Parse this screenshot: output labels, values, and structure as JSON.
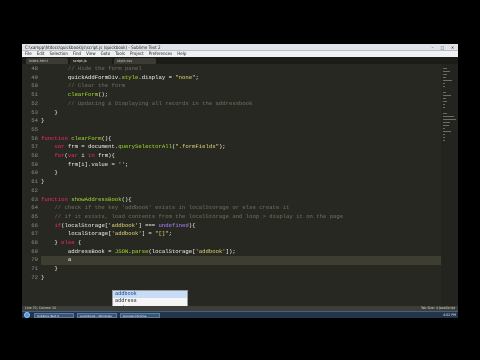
{
  "window": {
    "title": "C:\\xampp\\htdocs\\quickbook\\js\\script.js (quickbook) - Sublime Text 2",
    "buttons": [
      "–",
      "□",
      "✕"
    ]
  },
  "menubar": [
    "File",
    "Edit",
    "Selection",
    "Find",
    "View",
    "Goto",
    "Tools",
    "Project",
    "Preferences",
    "Help"
  ],
  "tabs": [
    {
      "label": "index.html",
      "active": false
    },
    {
      "label": "script.js",
      "active": true
    },
    {
      "label": "style.css",
      "active": false
    }
  ],
  "editor": {
    "current_line": 70,
    "lines": [
      {
        "n": "48",
        "parts": [
          [
            "        ",
            "tx"
          ],
          [
            "// Hide the form panel",
            "cm"
          ]
        ]
      },
      {
        "n": "49",
        "parts": [
          [
            "        quickAddFormDiv.",
            "tx"
          ],
          [
            "style",
            "fn"
          ],
          [
            ".display = ",
            "tx"
          ],
          [
            "\"none\"",
            "st"
          ],
          [
            ";",
            "tx"
          ]
        ]
      },
      {
        "n": "50",
        "parts": [
          [
            "        ",
            "tx"
          ],
          [
            "// Clear the form",
            "cm"
          ]
        ]
      },
      {
        "n": "51",
        "parts": [
          [
            "        ",
            "tx"
          ],
          [
            "clearForm",
            "fn"
          ],
          [
            "();",
            "tx"
          ]
        ]
      },
      {
        "n": "52",
        "parts": [
          [
            "        ",
            "tx"
          ],
          [
            "// Updating & Displaying all records in the addressbook",
            "cm"
          ]
        ]
      },
      {
        "n": "53",
        "parts": [
          [
            "    }",
            "tx"
          ]
        ]
      },
      {
        "n": "54",
        "parts": [
          [
            "}",
            "tx"
          ]
        ]
      },
      {
        "n": "55",
        "parts": [
          [
            "",
            "tx"
          ]
        ]
      },
      {
        "n": "56",
        "parts": [
          [
            "function",
            "kw"
          ],
          [
            " ",
            "tx"
          ],
          [
            "clearForm",
            "fn"
          ],
          [
            "(){",
            "tx"
          ]
        ]
      },
      {
        "n": "57",
        "parts": [
          [
            "    ",
            "tx"
          ],
          [
            "var",
            "kw"
          ],
          [
            " frm = document.",
            "tx"
          ],
          [
            "querySelectorAll",
            "fn"
          ],
          [
            "(",
            "tx"
          ],
          [
            "\".formFields\"",
            "st"
          ],
          [
            ");",
            "tx"
          ]
        ]
      },
      {
        "n": "58",
        "parts": [
          [
            "    ",
            "tx"
          ],
          [
            "for",
            "kw"
          ],
          [
            "(",
            "tx"
          ],
          [
            "var",
            "kw"
          ],
          [
            " i ",
            "tx"
          ],
          [
            "in",
            "kw"
          ],
          [
            " frm){",
            "tx"
          ]
        ]
      },
      {
        "n": "59",
        "parts": [
          [
            "        frm[i].value = ",
            "tx"
          ],
          [
            "''",
            "st"
          ],
          [
            ";",
            "tx"
          ]
        ]
      },
      {
        "n": "60",
        "parts": [
          [
            "    }",
            "tx"
          ]
        ]
      },
      {
        "n": "61",
        "parts": [
          [
            "}",
            "tx"
          ]
        ]
      },
      {
        "n": "62",
        "parts": [
          [
            "",
            "tx"
          ]
        ]
      },
      {
        "n": "63",
        "parts": [
          [
            "function",
            "kw"
          ],
          [
            " ",
            "tx"
          ],
          [
            "showAddressBook",
            "fn"
          ],
          [
            "(){",
            "tx"
          ]
        ]
      },
      {
        "n": "64",
        "parts": [
          [
            "    ",
            "tx"
          ],
          [
            "// check if the key 'addbook' exists in localStorage or else create it",
            "cm"
          ]
        ]
      },
      {
        "n": "65",
        "parts": [
          [
            "    ",
            "tx"
          ],
          [
            "// if it exists, load contents from the localStorage and loop > display it on the page",
            "cm"
          ]
        ]
      },
      {
        "n": "66",
        "parts": [
          [
            "    ",
            "tx"
          ],
          [
            "if",
            "kw"
          ],
          [
            "(localStorage[",
            "tx"
          ],
          [
            "'addbook'",
            "st"
          ],
          [
            "] === ",
            "tx"
          ],
          [
            "undefined",
            "nm"
          ],
          [
            "){",
            "tx"
          ]
        ]
      },
      {
        "n": "67",
        "parts": [
          [
            "        localStorage[",
            "tx"
          ],
          [
            "'addbook'",
            "st"
          ],
          [
            "] = ",
            "tx"
          ],
          [
            "\"[]\"",
            "st"
          ],
          [
            ";",
            "tx"
          ]
        ]
      },
      {
        "n": "68",
        "parts": [
          [
            "    } ",
            "tx"
          ],
          [
            "else",
            "kw"
          ],
          [
            " {",
            "tx"
          ]
        ]
      },
      {
        "n": "69",
        "parts": [
          [
            "        addressBook = ",
            "tx"
          ],
          [
            "JSON",
            "fn"
          ],
          [
            ".",
            "tx"
          ],
          [
            "parse",
            "fn"
          ],
          [
            "(localStorage[",
            "tx"
          ],
          [
            "'addbook'",
            "st"
          ],
          [
            "]);",
            "tx"
          ]
        ]
      },
      {
        "n": "70",
        "parts": [
          [
            "        a",
            "tx"
          ]
        ]
      },
      {
        "n": "71",
        "parts": [
          [
            "    }",
            "tx"
          ]
        ]
      },
      {
        "n": "72",
        "parts": [
          [
            "}",
            "tx"
          ]
        ]
      }
    ]
  },
  "autocomplete": {
    "items": [
      "addbook",
      "address",
      "and",
      "addressbook",
      "all",
      "array",
      "addressBook",
      "addEventListener"
    ],
    "selected_index": 0
  },
  "statusbar": {
    "left": "Line 70, Column 10",
    "right": "Tab Size: 4     JavaScript"
  },
  "taskbar": {
    "tasks": [
      "Sublime Text 2",
      "quickbook - Windows",
      "Google Chrome"
    ],
    "clock": "4:02 PM"
  }
}
